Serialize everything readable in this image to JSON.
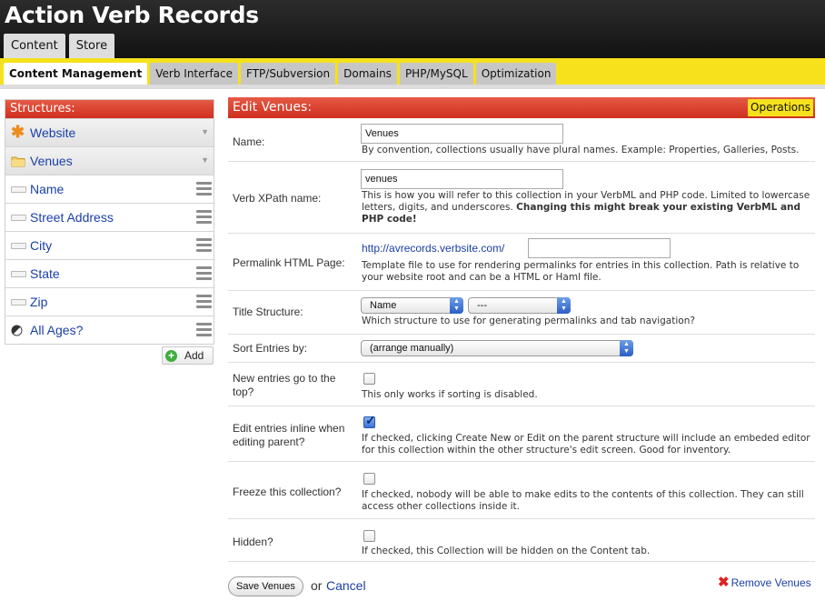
{
  "app": {
    "title": "Action Verb Records"
  },
  "main_tabs": [
    {
      "label": "Content"
    },
    {
      "label": "Store"
    }
  ],
  "sub_tabs": [
    {
      "label": "Content Management",
      "active": true
    },
    {
      "label": "Verb Interface"
    },
    {
      "label": "FTP/Subversion"
    },
    {
      "label": "Domains"
    },
    {
      "label": "PHP/MySQL"
    },
    {
      "label": "Optimization"
    }
  ],
  "sidebar": {
    "heading": "Structures:",
    "items": [
      {
        "label": "Website",
        "icon": "asterisk-icon",
        "type": "folder"
      },
      {
        "label": "Venues",
        "icon": "folder-icon",
        "type": "folder"
      },
      {
        "label": "Name",
        "icon": "text-field-icon",
        "type": "field"
      },
      {
        "label": "Street Address",
        "icon": "text-field-icon",
        "type": "field"
      },
      {
        "label": "City",
        "icon": "text-field-icon",
        "type": "field"
      },
      {
        "label": "State",
        "icon": "text-field-icon",
        "type": "field"
      },
      {
        "label": "Zip",
        "icon": "text-field-icon",
        "type": "field"
      },
      {
        "label": "All Ages?",
        "icon": "checkbox-field-icon",
        "type": "field"
      }
    ],
    "add_label": "Add"
  },
  "panel": {
    "title": "Edit Venues:",
    "operations_label": "Operations",
    "name": {
      "label": "Name:",
      "value": "Venues",
      "help": "By convention, collections usually have plural names. Example: Properties, Galleries, Posts."
    },
    "xpath": {
      "label": "Verb XPath name:",
      "value": "venues",
      "help": "This is how you will refer to this collection in your VerbML and PHP code. Limited to lowercase letters, digits, and underscores.",
      "warning": "Changing this might break your existing VerbML and PHP code!"
    },
    "permalink": {
      "label": "Permalink HTML Page:",
      "prefix": "http://avrecords.verbsite.com/",
      "value": "",
      "help": "Template file to use for rendering permalinks for entries in this collection. Path is relative to your website root and can be a HTML or Haml file."
    },
    "title_structure": {
      "label": "Title Structure:",
      "select1": "Name",
      "select2": "---",
      "help": "Which structure to use for generating permalinks and tab navigation?"
    },
    "sort": {
      "label": "Sort Entries by:",
      "value": "(arrange manually)"
    },
    "new_top": {
      "label": "New entries go to the top?",
      "checked": false,
      "help": "This only works if sorting is disabled."
    },
    "inline": {
      "label": "Edit entries inline when editing parent?",
      "checked": true,
      "help": "If checked, clicking Create New or Edit on the parent structure will include an embeded editor for this collection within the other structure's edit screen. Good for inventory."
    },
    "freeze": {
      "label": "Freeze this collection?",
      "checked": false,
      "help": "If checked, nobody will be able to make edits to the contents of this collection. They can still access other collections inside it."
    },
    "hidden": {
      "label": "Hidden?",
      "checked": false,
      "help": "If checked, this Collection will be hidden on the Content tab."
    }
  },
  "footer": {
    "save_label": "Save Venues",
    "or_text": "or",
    "cancel_label": "Cancel",
    "remove_label": "Remove Venues"
  },
  "colors": {
    "header_bg": "#1a1a1a",
    "accent_yellow": "#f6e11c",
    "section_red": "#d9382a",
    "link_blue": "#1a3fa8"
  }
}
